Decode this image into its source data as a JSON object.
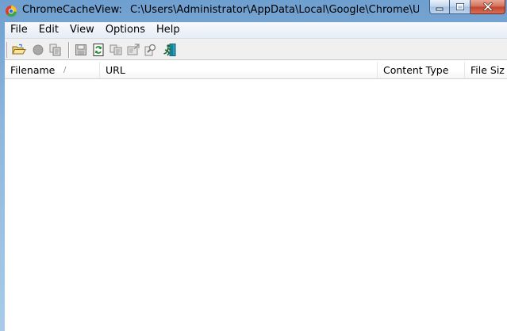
{
  "window": {
    "app_name": "ChromeCacheView:",
    "path": "C:\\Users\\Administrator\\AppData\\Local\\Google\\Chrome\\User D..."
  },
  "menu": {
    "items": [
      {
        "label": "File"
      },
      {
        "label": "Edit"
      },
      {
        "label": "View"
      },
      {
        "label": "Options"
      },
      {
        "label": "Help"
      }
    ]
  },
  "toolbar": {
    "buttons": [
      {
        "icon": "open-folder-icon"
      },
      {
        "icon": "stop-icon"
      },
      {
        "icon": "copy-files-icon"
      },
      {
        "icon": "save-icon"
      },
      {
        "icon": "refresh-icon"
      },
      {
        "icon": "copy-icon"
      },
      {
        "icon": "properties-icon"
      },
      {
        "icon": "find-icon"
      },
      {
        "icon": "exit-icon"
      }
    ]
  },
  "columns": [
    {
      "label": "Filename"
    },
    {
      "label": "URL"
    },
    {
      "label": "Content Type"
    },
    {
      "label": "File Siz"
    }
  ],
  "sort_indicator": "/",
  "colors": {
    "titlebar": "#8fb8de",
    "toolbar_bg": "#f0f0f0",
    "close_button": "#c2442a"
  }
}
